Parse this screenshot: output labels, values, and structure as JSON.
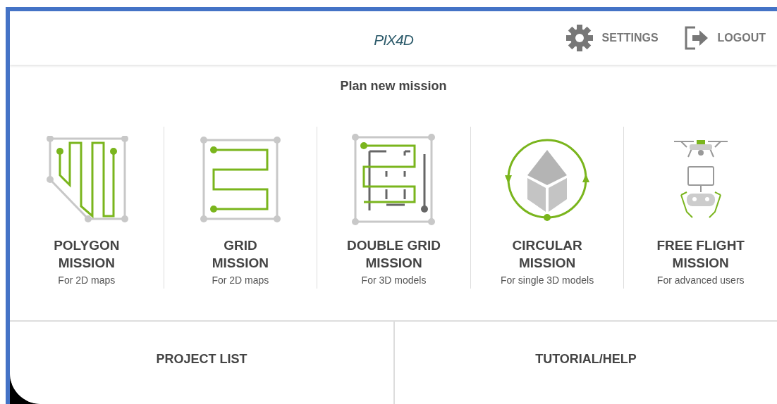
{
  "header": {
    "logo": "PIX4D",
    "actions": [
      {
        "kind": "settings",
        "label": "SETTINGS"
      },
      {
        "kind": "logout",
        "label": "LOGOUT"
      }
    ]
  },
  "title": "Plan new mission",
  "missions": [
    {
      "kind": "polygon",
      "title": "POLYGON",
      "title2": "MISSION",
      "subtitle": "For 2D maps"
    },
    {
      "kind": "grid",
      "title": "GRID",
      "title2": "MISSION",
      "subtitle": "For 2D maps"
    },
    {
      "kind": "double_grid",
      "title": "DOUBLE GRID",
      "title2": "MISSION",
      "subtitle": "For 3D models"
    },
    {
      "kind": "circular",
      "title": "CIRCULAR",
      "title2": "MISSION",
      "subtitle": "For single 3D models"
    },
    {
      "kind": "free_flight",
      "title": "FREE FLIGHT",
      "title2": "MISSION",
      "subtitle": "For advanced users"
    }
  ],
  "bottom_buttons": [
    "PROJECT LIST",
    "TUTORIAL/HELP"
  ]
}
